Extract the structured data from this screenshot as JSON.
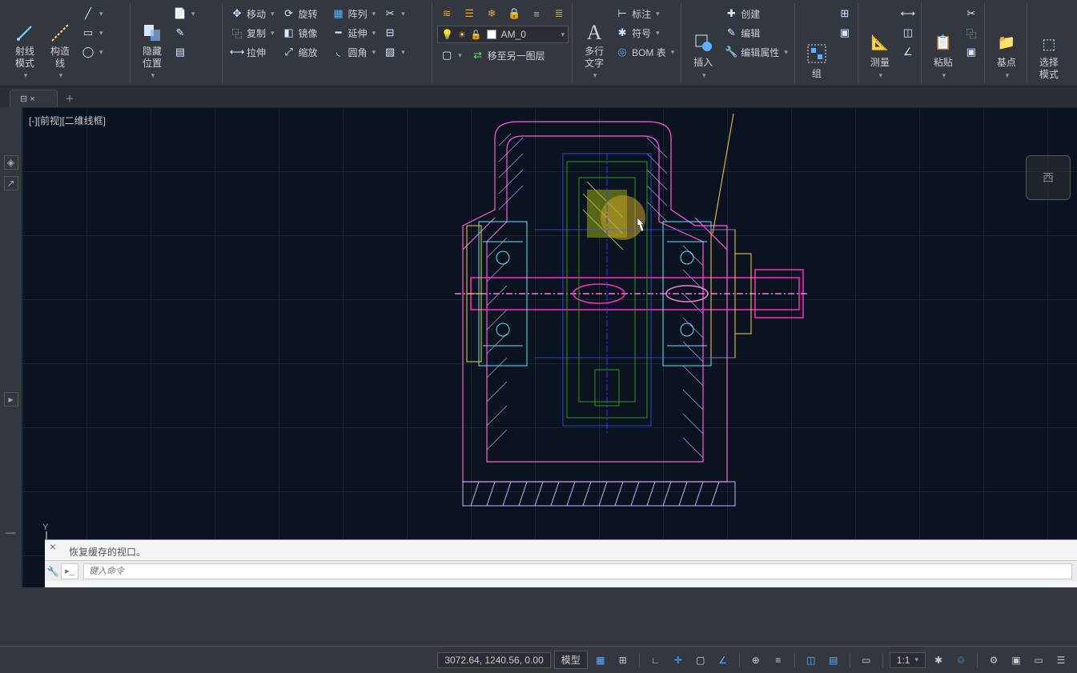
{
  "ribbon": {
    "draw": {
      "ray": "射线\n模式",
      "constr": "构造\n线"
    },
    "hide": "隐藏\n位置",
    "modify": {
      "move": "移动",
      "rotate": "旋转",
      "array": "阵列",
      "copy": "复制",
      "mirror": "镜像",
      "extend": "延伸",
      "stretch": "拉伸",
      "scale": "缩放",
      "fillet": "圆角"
    },
    "layer": {
      "current": "AM_0",
      "action": "移至另一图层"
    },
    "text": "多行\n文字",
    "annot": {
      "dim": "标注",
      "symbol": "符号",
      "bom": "BOM 表"
    },
    "insert": "插入",
    "block": {
      "create": "创建",
      "edit": "编辑",
      "attrs": "编辑属性"
    },
    "group": "组",
    "measure": "测量",
    "paste": "粘贴",
    "base": "基点",
    "select": "选择\n模式"
  },
  "document": {
    "tab": "",
    "viewport": "[-][前视][二维线框]",
    "viewcube": "西"
  },
  "commandline": {
    "history": "恢复缓存的视口。",
    "placeholder": "键入命令"
  },
  "status": {
    "coords": "3072.64, 1240.56, 0.00",
    "model": "模型",
    "scale": "1:1"
  }
}
